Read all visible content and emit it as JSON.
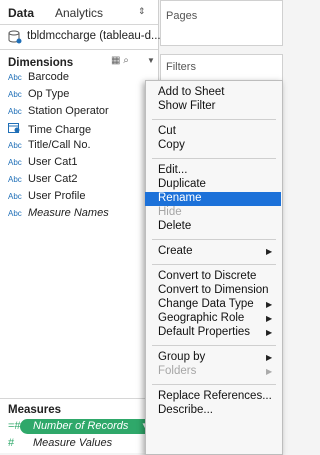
{
  "tabs": {
    "data": "Data",
    "analytics": "Analytics"
  },
  "datasource": {
    "name": "tbldmccharge (tableau-d..."
  },
  "dimensions": {
    "header": "Dimensions",
    "fields": [
      {
        "type": "Abc",
        "name": "Barcode"
      },
      {
        "type": "Abc",
        "name": "Op Type"
      },
      {
        "type": "Abc",
        "name": "Station Operator"
      },
      {
        "type": "datetime-icon",
        "name": "Time Charge"
      },
      {
        "type": "Abc",
        "name": "Title/Call No."
      },
      {
        "type": "Abc",
        "name": "User Cat1"
      },
      {
        "type": "Abc",
        "name": "User Cat2"
      },
      {
        "type": "Abc",
        "name": "User Profile"
      },
      {
        "type": "Abc",
        "name": "Measure Names"
      }
    ]
  },
  "measures": {
    "header": "Measures",
    "fields": [
      {
        "type": "=#",
        "name": "Number of Records"
      },
      {
        "type": "#",
        "name": "Measure Values"
      }
    ]
  },
  "shelves": {
    "pages": "Pages",
    "filters": "Filters"
  },
  "context_menu": {
    "items": [
      "Add to Sheet",
      "Show Filter",
      "Cut",
      "Copy",
      "Edit...",
      "Duplicate",
      "Rename",
      "Hide",
      "Delete",
      "Create",
      "Convert to Discrete",
      "Convert to Dimension",
      "Change Data Type",
      "Geographic Role",
      "Default Properties",
      "Group by",
      "Folders",
      "Replace References...",
      "Describe..."
    ],
    "highlighted": "Rename",
    "disabled": [
      "Hide",
      "Folders"
    ]
  },
  "colors": {
    "accent": "#1c71d9",
    "measure_pill": "#2fa86a",
    "type_blue": "#1f6fb7"
  }
}
